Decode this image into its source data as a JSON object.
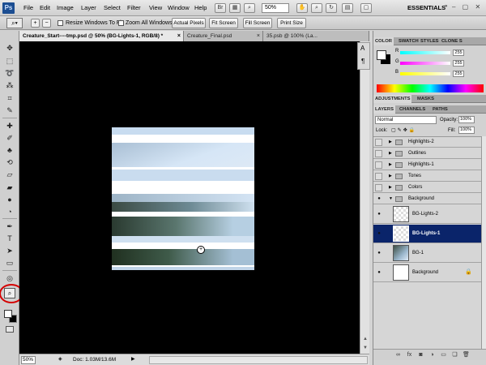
{
  "app": {
    "logo": "Ps",
    "menus": [
      "File",
      "Edit",
      "Image",
      "Layer",
      "Select",
      "Filter",
      "View",
      "Window",
      "Help"
    ],
    "zoom_level": "50%",
    "workspace": "ESSENTIALS"
  },
  "options_bar": {
    "resize_windows_label": "Resize Windows To Fit",
    "zoom_all_windows_label": "Zoom All Windows",
    "actual_pixels": "Actual Pixels",
    "fit_screen": "Fit Screen",
    "fill_screen": "Fill Screen",
    "print_size": "Print Size"
  },
  "tabs": [
    {
      "label": "Creature_Start----tmp.psd @ 50% (BG-Lights-1, RGB/8) *",
      "active": true
    },
    {
      "label": "Creature_Final.psd",
      "active": false
    },
    {
      "label": "35.psb @ 100% (La...",
      "active": false
    }
  ],
  "status": {
    "zoom": "50%",
    "doc_info": "Doc: 1.03M/13.6M"
  },
  "color_panel": {
    "tabs": [
      "COLOR",
      "SWATCH",
      "STYLES",
      "CLONE S"
    ],
    "r_label": "R",
    "g_label": "G",
    "b_label": "B",
    "r": "255",
    "g": "255",
    "b": "255"
  },
  "adjust_tabs": [
    "ADJUSTMENTS",
    "MASKS"
  ],
  "layers_panel": {
    "tabs": [
      "LAYERS",
      "CHANNELS",
      "PATHS"
    ],
    "blend_mode": "Normal",
    "opacity_label": "Opacity:",
    "opacity": "100%",
    "lock_label": "Lock:",
    "fill_label": "Fill:",
    "fill": "100%",
    "groups": [
      {
        "name": "Highlights-2",
        "visible": false
      },
      {
        "name": "Outlines",
        "visible": false
      },
      {
        "name": "Highlights-1",
        "visible": false
      },
      {
        "name": "Tones",
        "visible": false
      },
      {
        "name": "Colors",
        "visible": false
      },
      {
        "name": "Background",
        "visible": true
      }
    ],
    "layers": [
      {
        "name": "BG-Lights-2",
        "selected": false
      },
      {
        "name": "BG-Lights-1",
        "selected": true
      },
      {
        "name": "BG-1",
        "selected": false
      }
    ],
    "background_layer": "Background"
  },
  "icons": {
    "zoom_tool": "magnifier-icon",
    "hand": "hand-icon",
    "rotate": "rotate-view-icon",
    "eye": "eye-icon",
    "folder": "folder-icon",
    "lock": "lock-icon"
  },
  "colors": {
    "selected_layer": "#0a246a",
    "highlight_circle": "#d40000",
    "canvas_bg": "#000000"
  }
}
